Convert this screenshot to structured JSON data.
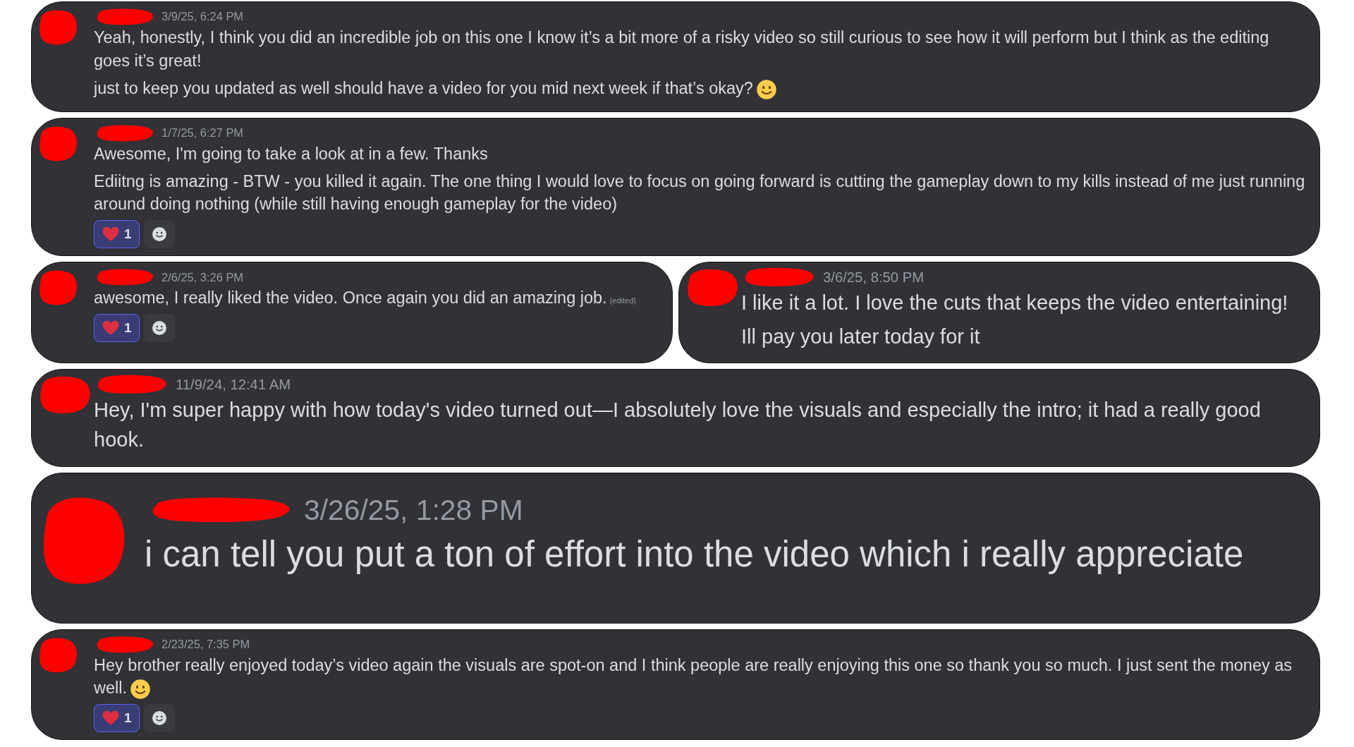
{
  "rows": [
    {
      "messages": [
        {
          "kind": "normal",
          "timestamp": "3/9/25, 6:24 PM",
          "lines": [
            "Yeah, honestly, I think you did an incredible job on this one I know it’s a bit more of a risky video so still curious to see how it will perform but I think as the editing goes it’s great!",
            "just to keep you updated as well should have a video for you mid next week if that’s okay?"
          ],
          "trailing_emoji": true
        }
      ]
    },
    {
      "messages": [
        {
          "kind": "normal",
          "timestamp": "1/7/25, 6:27 PM",
          "lines": [
            "Awesome, I'm going to take a look at in a few. Thanks",
            "Ediitng is amazing - BTW - you killed it again. The one thing I would love to focus on going forward is cutting the gameplay down to my kills instead of me just running around doing nothing  (while still having enough gameplay for the video)"
          ],
          "reactions": [
            {
              "count": "1",
              "reacted": true
            }
          ],
          "add_reaction": true
        }
      ]
    },
    {
      "messages": [
        {
          "kind": "normal",
          "timestamp": "2/6/25, 3:26 PM",
          "lines": [
            "awesome, I really liked the video. Once again you did an amazing job."
          ],
          "edited": "(edited)",
          "reactions": [
            {
              "count": "1",
              "reacted": true
            }
          ],
          "add_reaction": true
        },
        {
          "kind": "medium",
          "timestamp": "3/6/25, 8:50 PM",
          "lines": [
            "I like it a lot. I love the cuts that keeps the video entertaining!",
            "Ill pay you later today for it"
          ]
        }
      ]
    },
    {
      "messages": [
        {
          "kind": "medium",
          "timestamp": "11/9/24, 12:41 AM",
          "lines": [
            "Hey, I'm super happy with how today's video turned out—I absolutely love the visuals and especially the intro; it had a really good hook."
          ]
        }
      ]
    },
    {
      "messages": [
        {
          "kind": "large",
          "timestamp": "3/26/25, 1:28 PM",
          "lines": [
            "i can tell you put a ton of effort into the video which i really appreciate"
          ]
        }
      ]
    },
    {
      "messages": [
        {
          "kind": "normal",
          "timestamp": "2/23/25, 7:35 PM",
          "lines": [
            "Hey brother really enjoyed today’s video again the visuals are spot-on and I think people are really enjoying this one so thank you so much. I just sent the money as well."
          ],
          "trailing_emoji": true,
          "reactions": [
            {
              "count": "1",
              "reacted": true
            }
          ],
          "add_reaction": true
        }
      ]
    }
  ]
}
